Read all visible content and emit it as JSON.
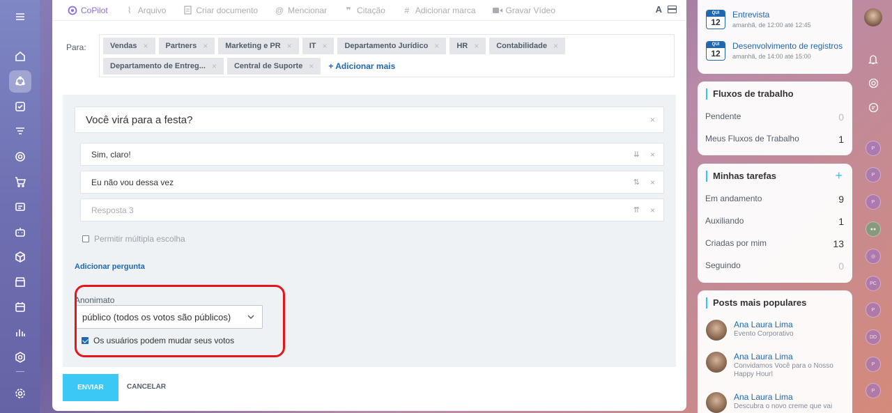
{
  "toolbar": {
    "items": [
      {
        "label": "CoPilot",
        "icon": "copilot-icon"
      },
      {
        "label": "Arquivo",
        "icon": "paperclip-icon"
      },
      {
        "label": "Criar documento",
        "icon": "document-icon"
      },
      {
        "label": "Mencionar",
        "icon": "at-icon"
      },
      {
        "label": "Citação",
        "icon": "quote-icon"
      },
      {
        "label": "Adicionar marca",
        "icon": "hash-icon"
      },
      {
        "label": "Gravar Vídeo",
        "icon": "video-icon"
      }
    ],
    "font_label": "A"
  },
  "recipients": {
    "label": "Para:",
    "chips": [
      "Vendas",
      "Partners",
      "Marketing e PR",
      "IT",
      "Departamento Jurídico",
      "HR",
      "Contabilidade",
      "Departamento de Entreg...",
      "Central de Suporte"
    ],
    "add_more": "+ Adicionar mais"
  },
  "poll": {
    "question": "Você virá para a festa?",
    "answers": [
      {
        "text": "Sim, claro!",
        "sort": "⇊"
      },
      {
        "text": "Eu não vou dessa vez",
        "sort": "⇅"
      },
      {
        "text": "Resposta 3",
        "sort": "⇈"
      }
    ],
    "multiple_choice_label": "Permitir múltipla escolha",
    "add_question": "Adicionar pergunta",
    "anonymity_label": "Anonimato",
    "anonymity_value": "público (todos os votos são públicos)",
    "change_votes_label": "Os usuários podem mudar seus votos"
  },
  "actions": {
    "send": "ENVIAR",
    "cancel": "CANCELAR"
  },
  "events": [
    {
      "day": "QUI",
      "num": "12",
      "title": "Entrevista",
      "time": "amanhã, de 12:00 até 12:45"
    },
    {
      "day": "QUI",
      "num": "12",
      "title": "Desenvolvimento de registros",
      "time": "amanhã, de 14:00 até 15:00"
    }
  ],
  "workflows": {
    "title": "Fluxos de trabalho",
    "rows": [
      {
        "label": "Pendente",
        "count": "0"
      },
      {
        "label": "Meus Fluxos de Trabalho",
        "count": "1"
      }
    ]
  },
  "tasks": {
    "title": "Minhas tarefas",
    "rows": [
      {
        "label": "Em andamento",
        "count": "9"
      },
      {
        "label": "Auxiliando",
        "count": "1"
      },
      {
        "label": "Criadas por mim",
        "count": "13"
      },
      {
        "label": "Seguindo",
        "count": "0"
      }
    ]
  },
  "popular": {
    "title": "Posts mais populares",
    "posts": [
      {
        "name": "Ana Laura Lima",
        "text": "Evento Corporativo"
      },
      {
        "name": "Ana Laura Lima",
        "text": "Convidamos Você para o Nosso Happy Hour!"
      },
      {
        "name": "Ana Laura Lima",
        "text": "Descubra o novo creme que vai"
      }
    ]
  },
  "right_strip": [
    "P",
    "P",
    "P",
    "PC",
    "P",
    "DD",
    "P",
    "P"
  ],
  "colors": {
    "accent": "#2067b0",
    "send": "#3bc8f5",
    "highlight": "#e8141c",
    "copilot": "#8e6bd9"
  }
}
